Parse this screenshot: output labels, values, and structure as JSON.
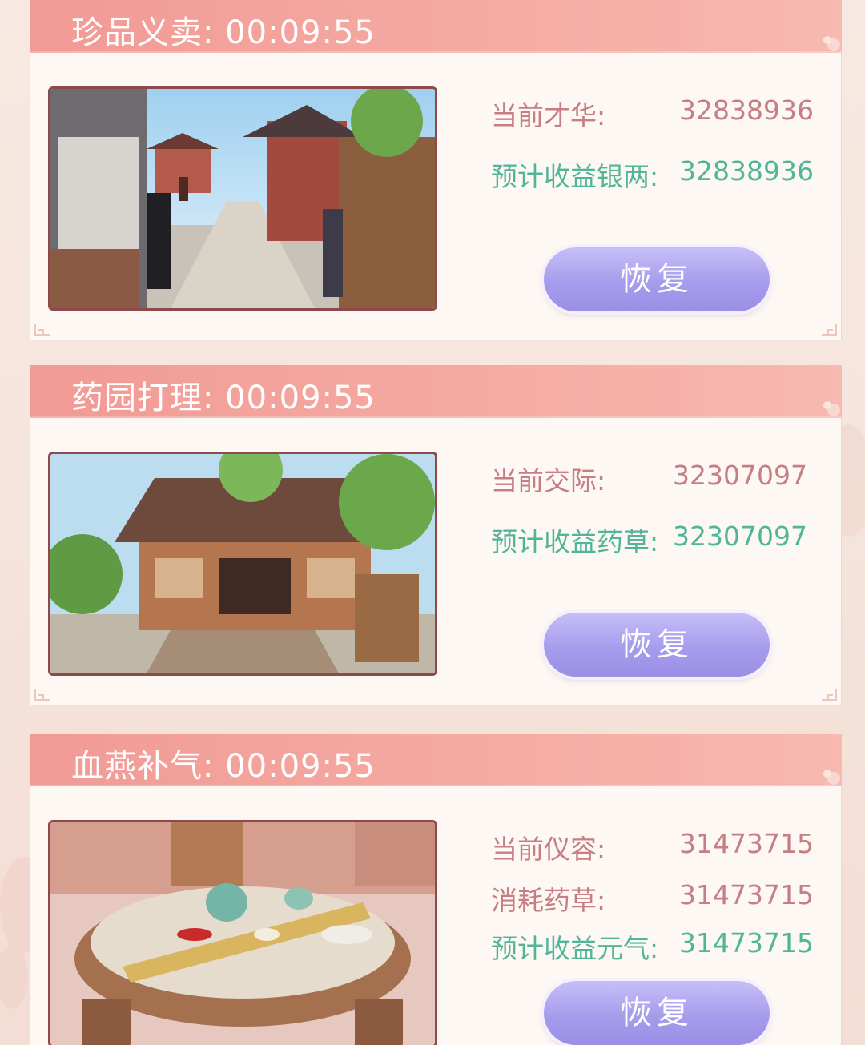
{
  "cards": [
    {
      "title": "珍品义卖: 00:09:55",
      "rows": [
        {
          "label": "当前才华:",
          "value": "32838936",
          "color": "pink"
        },
        {
          "label": "预计收益银两:",
          "value": "32838936",
          "color": "green"
        }
      ],
      "button_label": "恢复",
      "scene": "market-street-scene"
    },
    {
      "title": "药园打理: 00:09:55",
      "rows": [
        {
          "label": "当前交际:",
          "value": "32307097",
          "color": "pink"
        },
        {
          "label": "预计收益药草:",
          "value": "32307097",
          "color": "green"
        }
      ],
      "button_label": "恢复",
      "scene": "herb-garden-scene"
    },
    {
      "title": "血燕补气: 00:09:55",
      "rows": [
        {
          "label": "当前仪容:",
          "value": "31473715",
          "color": "pink"
        },
        {
          "label": "消耗药草:",
          "value": "31473715",
          "color": "pink"
        },
        {
          "label": "预计收益元气:",
          "value": "31473715",
          "color": "green"
        }
      ],
      "button_label": "恢复",
      "scene": "tea-table-scene"
    }
  ],
  "colors": {
    "header": "#f29a95",
    "label_pink": "#c67e84",
    "label_green": "#52b59a",
    "button": "#a69cec"
  }
}
